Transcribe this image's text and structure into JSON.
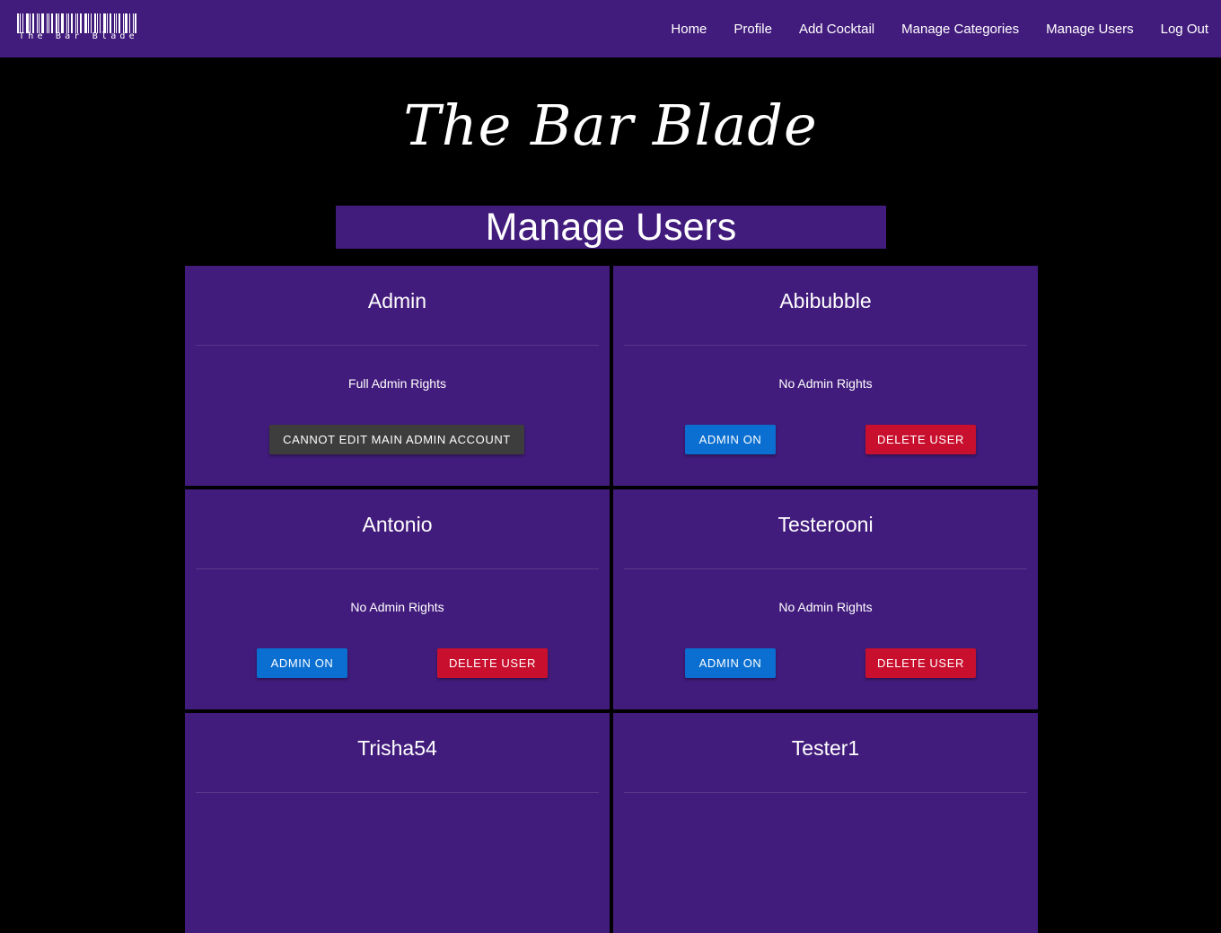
{
  "navbar": {
    "logo_text": "The Bar Blade",
    "links": [
      "Home",
      "Profile",
      "Add Cocktail",
      "Manage Categories",
      "Manage Users",
      "Log Out"
    ]
  },
  "brand": {
    "title": "The Bar Blade"
  },
  "page": {
    "heading": "Manage Users"
  },
  "users": [
    {
      "name": "Admin",
      "rights": "Full Admin Rights",
      "locked_label": "CANNOT EDIT MAIN ADMIN ACCOUNT"
    },
    {
      "name": "Abibubble",
      "rights": "No Admin Rights",
      "admin_label": "ADMIN ON",
      "delete_label": "DELETE USER"
    },
    {
      "name": "Antonio",
      "rights": "No Admin Rights",
      "admin_label": "ADMIN ON",
      "delete_label": "DELETE USER"
    },
    {
      "name": "Testerooni",
      "rights": "No Admin Rights",
      "admin_label": "ADMIN ON",
      "delete_label": "DELETE USER"
    },
    {
      "name": "Trisha54"
    },
    {
      "name": "Tester1"
    }
  ],
  "colors": {
    "primary_purple": "#421c7c",
    "background": "#000000",
    "admin_button_blue": "#0a6fd1",
    "delete_button_red": "#c8102e",
    "locked_button_gray": "#3d3d3d"
  }
}
